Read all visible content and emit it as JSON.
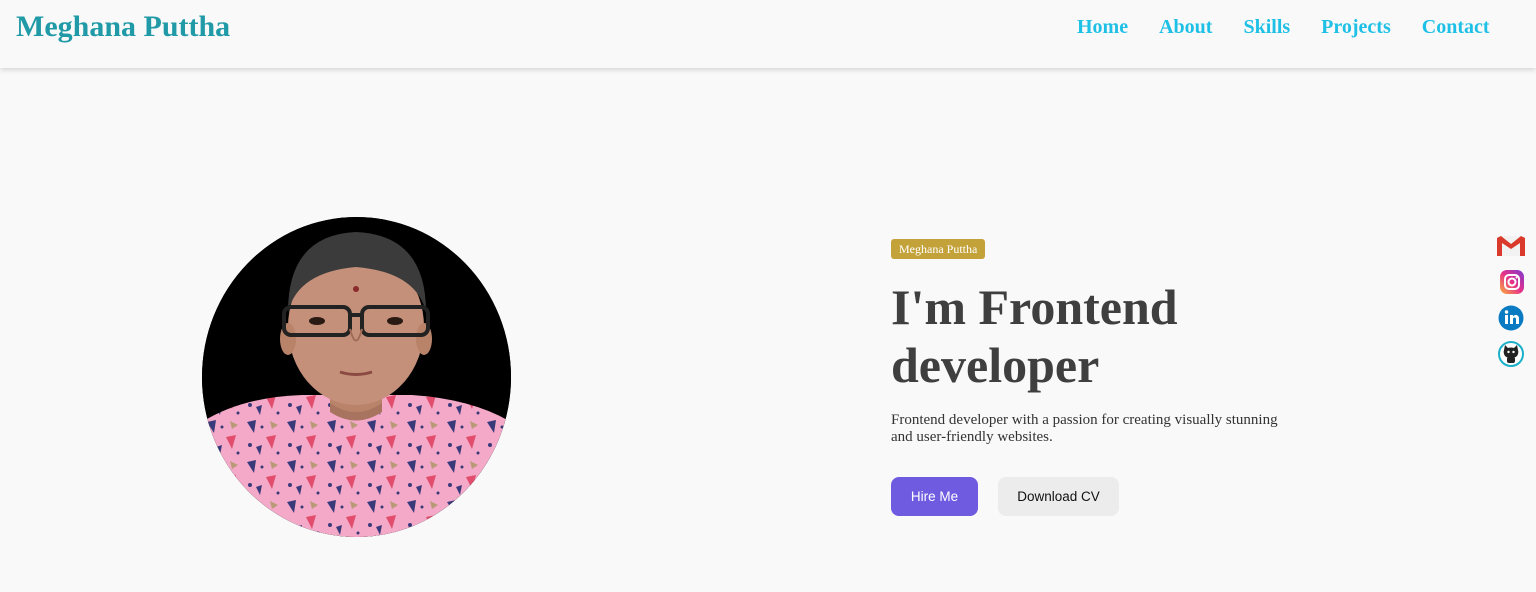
{
  "navbar": {
    "brand": "Meghana Puttha",
    "links": [
      {
        "label": "Home"
      },
      {
        "label": "About"
      },
      {
        "label": "Skills"
      },
      {
        "label": "Projects"
      },
      {
        "label": "Contact"
      }
    ]
  },
  "hero": {
    "badge": "Meghana Puttha",
    "headline": "I'm Frontend developer",
    "description": "Frontend developer with a passion for creating visually stunning and user-friendly websites.",
    "primary_button": "Hire Me",
    "secondary_button": "Download CV",
    "avatar": "profile-photo"
  },
  "social": [
    {
      "icon": "gmail-icon"
    },
    {
      "icon": "instagram-icon"
    },
    {
      "icon": "linkedin-icon"
    },
    {
      "icon": "github-icon"
    }
  ],
  "colors": {
    "brand": "#1f9aa6",
    "nav_link": "#1ec0e6",
    "badge": "#c4a23a",
    "headline": "#3f3f3f",
    "primary_button": "#6f5be0",
    "secondary_button": "#ececec"
  }
}
